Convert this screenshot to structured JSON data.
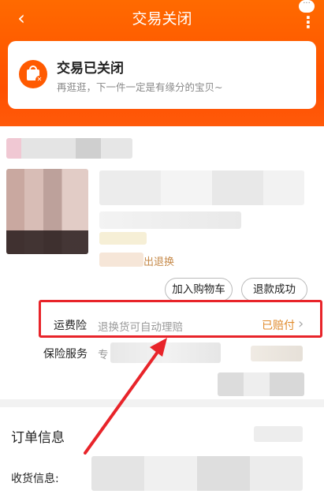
{
  "header": {
    "title": "交易关闭",
    "back_icon": "chevron-left-icon",
    "more_bubble": "···",
    "more_icon": "⋮"
  },
  "status": {
    "title": "交易已关闭",
    "subtitle": "再逛逛，下一件一定是有缘分的宝贝~",
    "icon": "closed-bag-icon",
    "accent_color": "#ff5a00"
  },
  "item": {
    "refund_label": "出退换",
    "buttons": {
      "add_to_cart": "加入购物车",
      "refund_success": "退款成功"
    }
  },
  "shipping_insurance": {
    "label": "运费险",
    "description": "退换货可自动理赔",
    "status": "已赔付",
    "chevron": "›"
  },
  "insurance_service": {
    "label": "保险服务",
    "description_partial": "专"
  },
  "order": {
    "section_title": "订单信息",
    "shipping_label": "收货信息:"
  },
  "annotation_color": "#e8242a"
}
